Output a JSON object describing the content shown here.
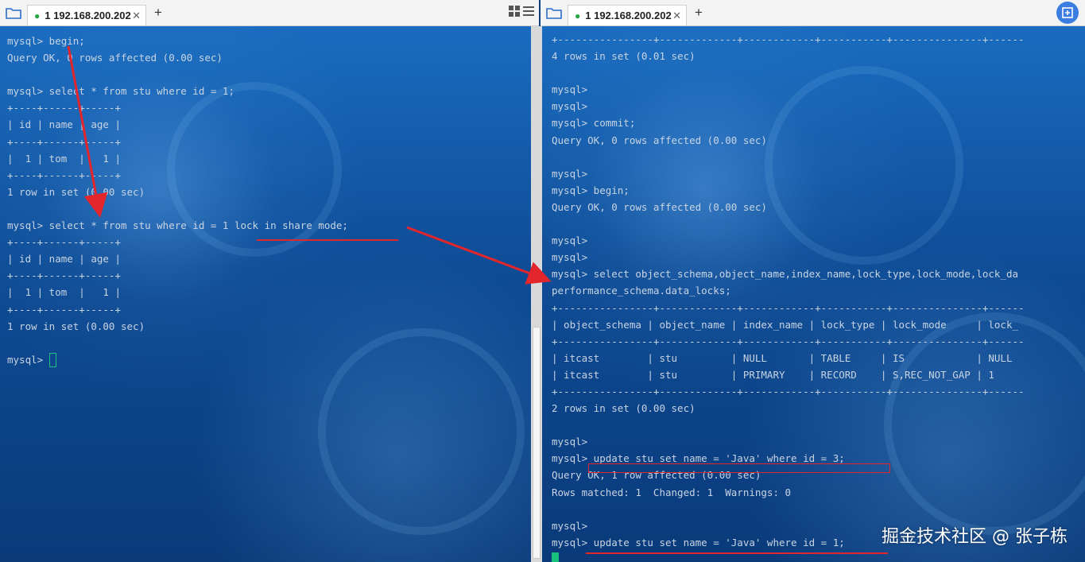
{
  "left_window": {
    "tab_label": "1 192.168.200.202",
    "terminal_lines": [
      "mysql> begin;",
      "Query OK, 0 rows affected (0.00 sec)",
      "",
      "mysql> select * from stu where id = 1;",
      "+----+------+-----+",
      "| id | name | age |",
      "+----+------+-----+",
      "|  1 | tom  |   1 |",
      "+----+------+-----+",
      "1 row in set (0.00 sec)",
      "",
      "mysql> select * from stu where id = 1 lock in share mode;",
      "+----+------+-----+",
      "| id | name | age |",
      "+----+------+-----+",
      "|  1 | tom  |   1 |",
      "+----+------+-----+",
      "1 row in set (0.00 sec)",
      "",
      "mysql> "
    ]
  },
  "right_window": {
    "tab_label": "1 192.168.200.202",
    "terminal_lines": [
      "+----------------+-------------+------------+-----------+---------------+------",
      "4 rows in set (0.01 sec)",
      "",
      "mysql>",
      "mysql>",
      "mysql> commit;",
      "Query OK, 0 rows affected (0.00 sec)",
      "",
      "mysql>",
      "mysql> begin;",
      "Query OK, 0 rows affected (0.00 sec)",
      "",
      "mysql>",
      "mysql>",
      "mysql> select object_schema,object_name,index_name,lock_type,lock_mode,lock_da",
      "performance_schema.data_locks;",
      "+----------------+-------------+------------+-----------+---------------+------",
      "| object_schema | object_name | index_name | lock_type | lock_mode     | lock_",
      "+----------------+-------------+------------+-----------+---------------+------",
      "| itcast        | stu         | NULL       | TABLE     | IS            | NULL",
      "| itcast        | stu         | PRIMARY    | RECORD    | S,REC_NOT_GAP | 1",
      "+----------------+-------------+------------+-----------+---------------+------",
      "2 rows in set (0.00 sec)",
      "",
      "mysql>",
      "mysql> update stu set name = 'Java' where id = 3;",
      "Query OK, 1 row affected (0.00 sec)",
      "Rows matched: 1  Changed: 1  Warnings: 0",
      "",
      "mysql>",
      "mysql> update stu set name = 'Java' where id = 1;"
    ]
  },
  "watermark": "掘金技术社区 @ 张子栋",
  "colors": {
    "terminal_text": "#c8d4e2",
    "annotation_red": "#e3262b",
    "cursor_green": "#19c37d"
  }
}
